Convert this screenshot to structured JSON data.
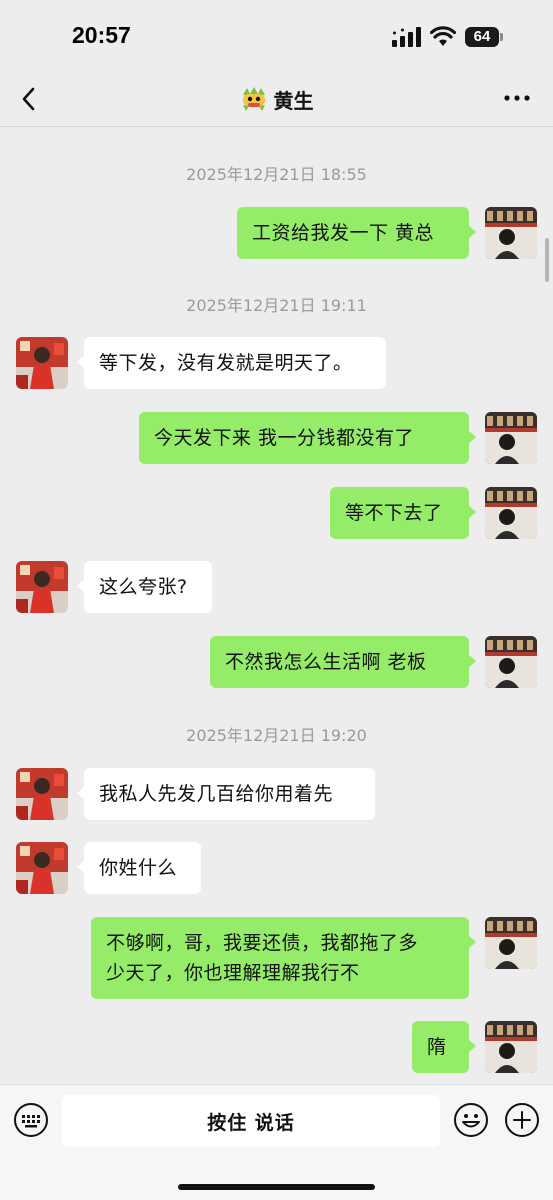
{
  "status_bar": {
    "time": "20:57",
    "battery": "64"
  },
  "nav": {
    "title": "黄生",
    "title_icon": "dragon-emoji-icon",
    "back_icon": "chevron-left-icon",
    "more_icon": "more-dots-icon"
  },
  "messages": {
    "ts1": "2025年12月21日 18:55",
    "m1": "工资给我发一下 黄总",
    "ts2": "2025年12月21日 19:11",
    "m2": "等下发，没有发就是明天了。",
    "m3": "今天发下来 我一分钱都没有了",
    "m4": "等不下去了",
    "m5": "这么夸张?",
    "m6": "不然我怎么生活啊 老板",
    "ts3": "2025年12月21日 19:20",
    "m7": "我私人先发几百给你用着先",
    "m8": "你姓什么",
    "m9_line1": "不够啊，哥，我要还债，我都拖了多",
    "m9_line2": "少天了，你也理解理解我行不",
    "m10": "隋"
  },
  "input_bar": {
    "hold_to_talk": "按住 说话",
    "keyboard_icon": "keyboard-icon",
    "emoji_icon": "smiley-icon",
    "plus_icon": "plus-circle-icon"
  },
  "colors": {
    "my_bubble": "#95ec69",
    "their_bubble": "#ffffff",
    "background": "#ededed"
  }
}
